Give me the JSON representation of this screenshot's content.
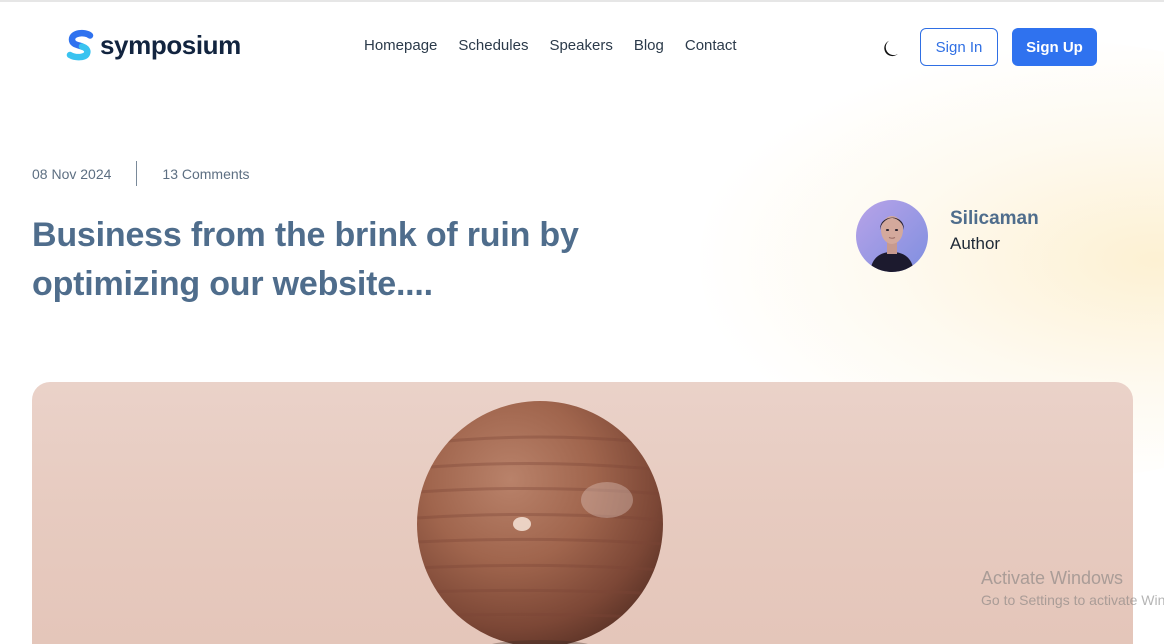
{
  "brand": {
    "name": "symposium",
    "logo_icon": "s-logo-icon",
    "colors": {
      "primary": "#2f72ef",
      "accent": "#39c3f0",
      "text": "#12243f"
    }
  },
  "nav": {
    "items": [
      {
        "label": "Homepage"
      },
      {
        "label": "Schedules"
      },
      {
        "label": "Speakers"
      },
      {
        "label": "Blog"
      },
      {
        "label": "Contact"
      }
    ]
  },
  "header_actions": {
    "theme_toggle_icon": "moon-icon",
    "sign_in_label": "Sign In",
    "sign_up_label": "Sign Up"
  },
  "post": {
    "date": "08 Nov 2024",
    "comments": "13 Comments",
    "title": "Business from the brink of ruin by optimizing our website....",
    "title_color": "#4f6d8c"
  },
  "author": {
    "name": "Silicaman",
    "role": "Author",
    "avatar_icon": "author-avatar"
  },
  "hero": {
    "image": "wooden-sphere-photo"
  },
  "os_overlay": {
    "title": "Activate Windows",
    "subtitle": "Go to Settings to activate Windows."
  }
}
